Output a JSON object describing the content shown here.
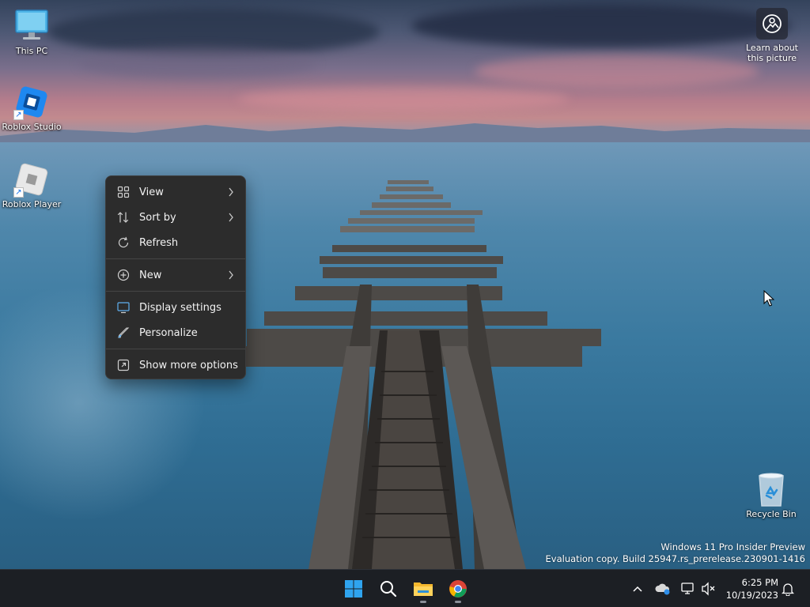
{
  "desktop": {
    "icons": [
      {
        "label": "This PC"
      },
      {
        "label": "Roblox Studio"
      },
      {
        "label": "Roblox Player"
      },
      {
        "label": "Recycle Bin"
      }
    ],
    "learn_about": "Learn about this picture"
  },
  "context_menu": {
    "items": [
      {
        "label": "View",
        "icon": "grid-icon",
        "submenu": true
      },
      {
        "label": "Sort by",
        "icon": "sort-icon",
        "submenu": true
      },
      {
        "label": "Refresh",
        "icon": "refresh-icon",
        "submenu": false
      },
      {
        "label": "New",
        "icon": "plus-circle-icon",
        "submenu": true
      },
      {
        "label": "Display settings",
        "icon": "display-icon",
        "submenu": false
      },
      {
        "label": "Personalize",
        "icon": "brush-icon",
        "submenu": false
      },
      {
        "label": "Show more options",
        "icon": "expand-icon",
        "submenu": false
      }
    ]
  },
  "watermark": {
    "line1": "Windows 11 Pro Insider Preview",
    "line2": "Evaluation copy. Build 25947.rs_prerelease.230901-1416"
  },
  "taskbar": {
    "apps": [
      "start-icon",
      "search-icon",
      "file-explorer-icon",
      "chrome-icon"
    ],
    "tray": [
      "chevron-up-icon",
      "onedrive-icon",
      "network-icon",
      "volume-muted-icon",
      "notification-bell-icon"
    ],
    "time": "6:25 PM",
    "date": "10/19/2023"
  },
  "colors": {
    "menu_bg": "#2c2c2c",
    "taskbar_bg": "#1c1f24",
    "accent": "#1a73e8"
  }
}
